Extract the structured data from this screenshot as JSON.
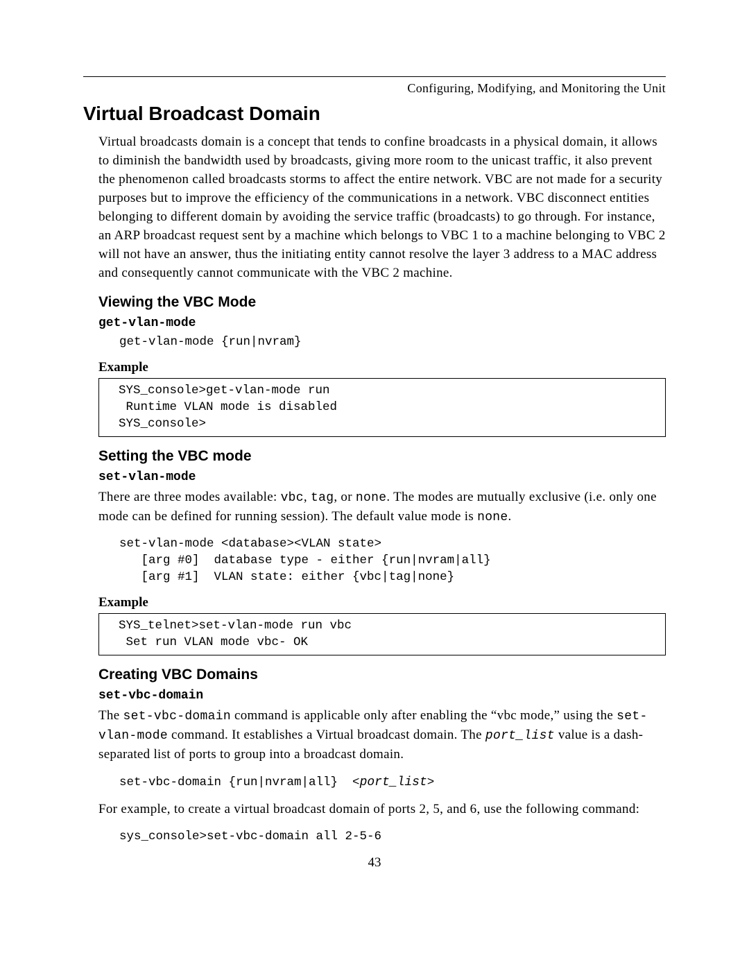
{
  "running_head": "Configuring, Modifying, and Monitoring the Unit",
  "h1": "Virtual Broadcast Domain",
  "intro": "Virtual broadcasts domain is a concept that tends to confine broadcasts in a physical domain, it allows to diminish the bandwidth used by broadcasts, giving more room to the unicast traffic, it also prevent the phenomenon called broadcasts storms to affect the entire network.  VBC are not made for a security purposes but to improve the efficiency of the communications in a network.  VBC disconnect entities belonging to different domain by avoiding the service traffic (broadcasts) to go through.  For instance, an ARP broadcast request sent by a machine which belongs to VBC 1 to a machine belonging to VBC 2 will not have an answer, thus the initiating entity cannot resolve the layer 3 address to a MAC address and consequently cannot communicate with the VBC 2 machine.",
  "sec1": {
    "heading": "Viewing the VBC Mode",
    "cmd_label": "get-vlan-mode",
    "syntax": "get-vlan-mode {run|nvram}",
    "example_label": "Example",
    "example_code": "SYS_console>get-vlan-mode run\n Runtime VLAN mode is disabled\nSYS_console>"
  },
  "sec2": {
    "heading": "Setting the VBC mode",
    "cmd_label": "set-vlan-mode",
    "para_before": "There are three modes available: ",
    "modes_inline": "vbc",
    "comma1": ", ",
    "modes_inline2": "tag",
    "comma2": ", or ",
    "modes_inline3": "none",
    "para_mid": ".  The modes are mutually exclusive (i.e. only one mode can be defined for running session).  The default value mode is ",
    "default_mode": "none",
    "para_end": ".",
    "syntax": "set-vlan-mode <database><VLAN state>\n   [arg #0]  database type - either {run|nvram|all}\n   [arg #1]  VLAN state: either {vbc|tag|none}",
    "example_label": "Example",
    "example_code": "SYS_telnet>set-vlan-mode run vbc\n Set run VLAN mode vbc- OK"
  },
  "sec3": {
    "heading": "Creating VBC Domains",
    "cmd_label": "set-vbc-domain",
    "para1_a": "The ",
    "para1_cmd1": "set-vbc-domain",
    "para1_b": " command is applicable only after enabling the “vbc mode,” using the ",
    "para1_cmd2": "set-vlan-mode",
    "para1_c": " command.  It establishes a Virtual broadcast domain.  The ",
    "para1_var": "port_list",
    "para1_d": " value is a dash-separated list of ports to group into a broadcast domain.",
    "syntax_a": "set-vbc-domain {run|nvram|all}  <",
    "syntax_var": "port_list",
    "syntax_b": ">",
    "para2": "For example, to create a virtual broadcast domain of ports 2, 5, and 6, use the following command:",
    "example_code": "sys_console>set-vbc-domain all 2-5-6"
  },
  "page_number": "43"
}
